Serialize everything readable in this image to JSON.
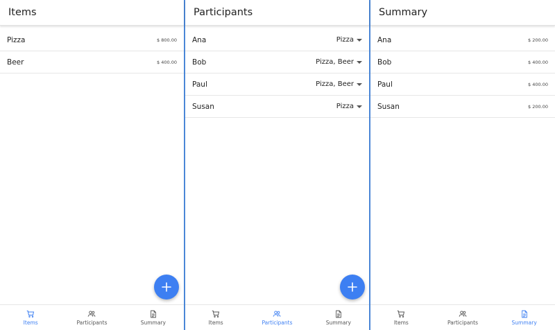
{
  "accent": "#3d7ff2",
  "tabs": [
    {
      "label": "Items",
      "icon": "cart-icon"
    },
    {
      "label": "Participants",
      "icon": "people-icon"
    },
    {
      "label": "Summary",
      "icon": "document-icon"
    }
  ],
  "screens": {
    "items": {
      "title": "Items",
      "rows": [
        {
          "name": "Pizza",
          "amount": "$ 800.00"
        },
        {
          "name": "Beer",
          "amount": "$ 400.00"
        }
      ],
      "active_tab": "Items"
    },
    "participants": {
      "title": "Participants",
      "rows": [
        {
          "name": "Ana",
          "selection": "Pizza"
        },
        {
          "name": "Bob",
          "selection": "Pizza, Beer"
        },
        {
          "name": "Paul",
          "selection": "Pizza, Beer"
        },
        {
          "name": "Susan",
          "selection": "Pizza"
        }
      ],
      "active_tab": "Participants"
    },
    "summary": {
      "title": "Summary",
      "rows": [
        {
          "name": "Ana",
          "amount": "$ 200.00"
        },
        {
          "name": "Bob",
          "amount": "$ 400.00"
        },
        {
          "name": "Paul",
          "amount": "$ 400.00"
        },
        {
          "name": "Susan",
          "amount": "$ 200.00"
        }
      ],
      "active_tab": "Summary"
    }
  }
}
